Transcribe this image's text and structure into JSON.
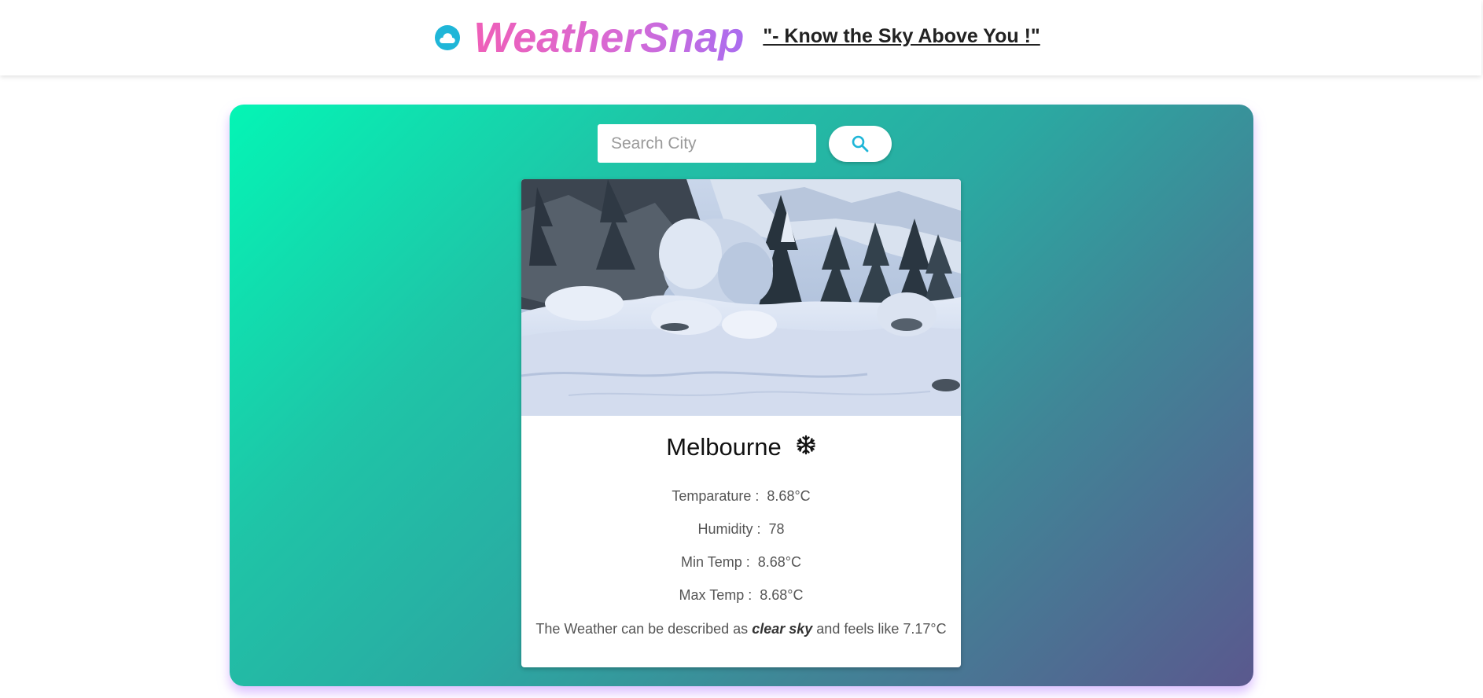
{
  "header": {
    "brand": "WeatherSnap",
    "tagline": "\"- Know the Sky Above You !\"",
    "logo_icon": "cloud-icon",
    "brand_gradient": [
      "#ef5fb8",
      "#a86df0"
    ]
  },
  "search": {
    "placeholder": "Search City",
    "value": "",
    "button_icon": "search-icon",
    "accent": "#1fb6d8"
  },
  "weather": {
    "image_alt": "snowy forest",
    "city": "Melbourne",
    "condition_icon": "snowflake-icon",
    "temperature_label": "Temparature :",
    "temperature_value": "8.68°C",
    "humidity_label": "Humidity :",
    "humidity_value": "78",
    "min_label": "Min Temp :",
    "min_value": "8.68°C",
    "max_label": "Max Temp :",
    "max_value": "8.68°C",
    "desc_prefix": "The Weather can be described as",
    "desc_condition": "clear sky",
    "desc_suffix": "and feels like",
    "feels_like": "7.17°C"
  }
}
